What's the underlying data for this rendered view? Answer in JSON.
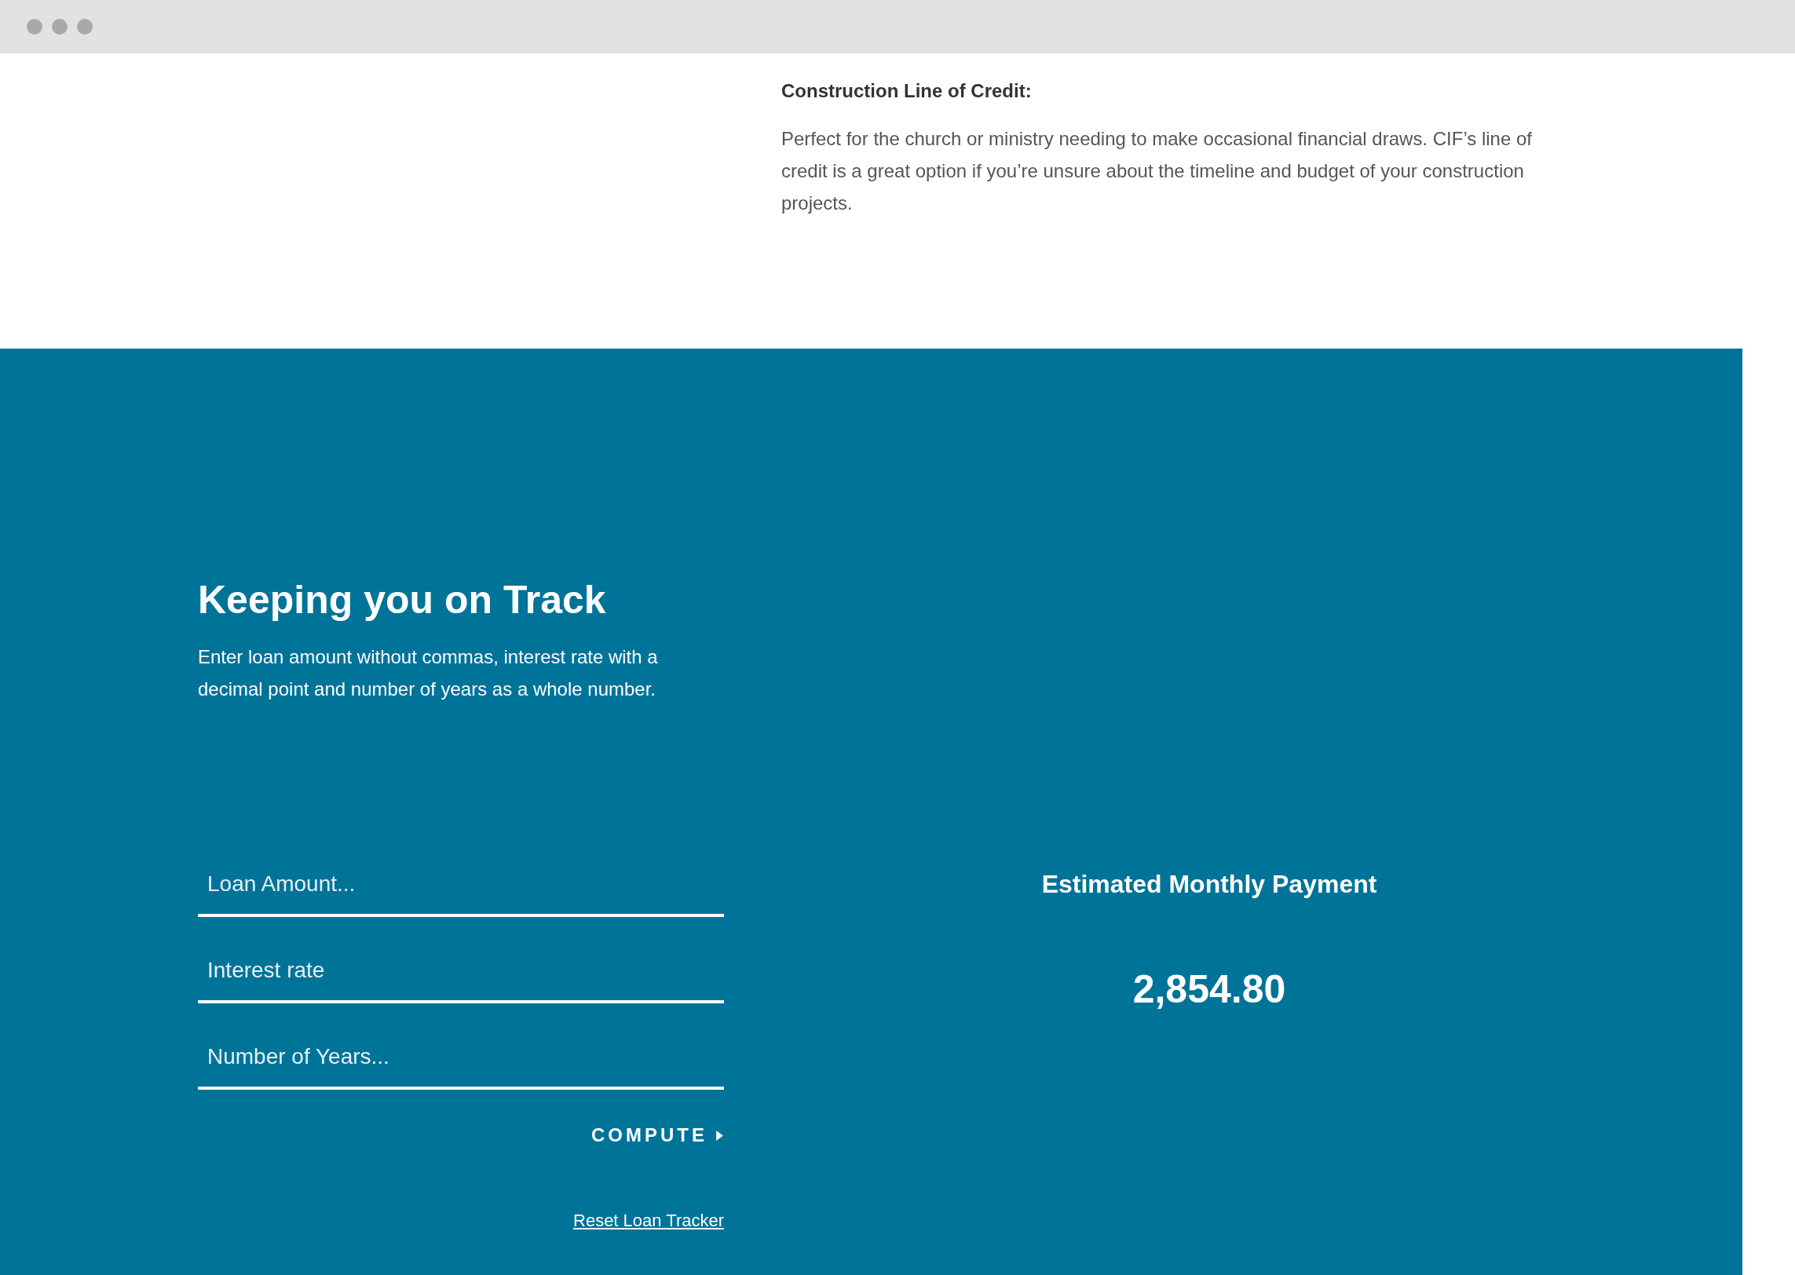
{
  "info": {
    "heading": "Construction Line of Credit:",
    "body": "Perfect for the church or ministry needing to make occasional financial draws. CIF’s line of credit is a great option if you’re unsure about the timeline and budget of your construction projects."
  },
  "calculator": {
    "title": "Keeping you on Track",
    "description": "Enter loan amount without commas, interest rate with a decimal point and number of years as a whole number.",
    "fields": [
      {
        "placeholder": "Loan Amount..."
      },
      {
        "placeholder": "Interest rate"
      },
      {
        "placeholder": "Number of Years..."
      }
    ],
    "compute_button": "COMPUTE",
    "reset_link": "Reset Loan Tracker",
    "result_label": "Estimated Monthly Payment",
    "result_value": "2,854.80"
  }
}
